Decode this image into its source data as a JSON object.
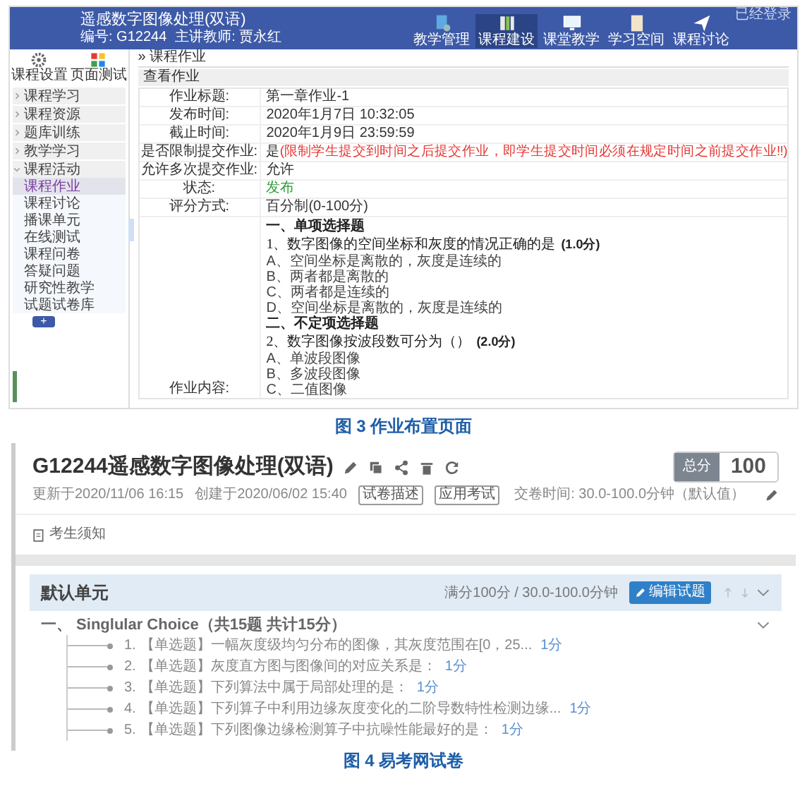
{
  "figure3": {
    "caption": "图 3 作业布置页面",
    "header": {
      "title": "遥感数字图像处理(双语)",
      "code": "编号: G12244",
      "teacher": "主讲教师: 贾永红",
      "login": "已经登录",
      "toolbar": [
        {
          "kind": "settings",
          "label": "教学管理",
          "selected": false
        },
        {
          "kind": "chart",
          "label": "课程建设",
          "selected": true
        },
        {
          "kind": "monitor",
          "label": "课堂教学",
          "selected": false
        },
        {
          "kind": "document",
          "label": "学习空间",
          "selected": false
        },
        {
          "kind": "send",
          "label": "课程讨论",
          "selected": false
        }
      ]
    },
    "sidebar": {
      "tools": [
        {
          "kind": "gear",
          "label": "课程设置"
        },
        {
          "kind": "grid",
          "label": "页面测试"
        }
      ],
      "groups": [
        {
          "label": "课程学习",
          "expanded": false
        },
        {
          "label": "课程资源",
          "expanded": false
        },
        {
          "label": "题库训练",
          "expanded": false
        },
        {
          "label": "教学学习",
          "expanded": false
        },
        {
          "label": "课程活动",
          "expanded": true,
          "children": [
            {
              "label": "课程作业",
              "selected": true
            },
            {
              "label": "课程讨论",
              "selected": false
            },
            {
              "label": "播课单元",
              "selected": false
            },
            {
              "label": "在线测试",
              "selected": false
            },
            {
              "label": "课程问卷",
              "selected": false
            },
            {
              "label": "答疑问题",
              "selected": false
            },
            {
              "label": "研究性教学",
              "selected": false
            },
            {
              "label": "试题试卷库",
              "selected": false
            }
          ]
        }
      ],
      "add_button": "+"
    },
    "breadcrumb": "» 课程作业",
    "section": "查看作业",
    "rows": [
      {
        "kind": "text",
        "label": "作业标题:",
        "value": "第一章作业-1"
      },
      {
        "kind": "text",
        "label": "发布时间:",
        "value": "2020年1月7日 10:32:05"
      },
      {
        "kind": "text",
        "label": "截止时间:",
        "value": "2020年1月9日 23:59:59"
      },
      {
        "kind": "warning",
        "label": "是否限制提交作业:",
        "value": "是",
        "note": "(限制学生提交到时间之后提交作业，即学生提交时间必须在规定时间之前提交作业!!)"
      },
      {
        "kind": "text",
        "label": "允许多次提交作业:",
        "value": "允许"
      },
      {
        "kind": "status",
        "label": "状态:",
        "value": "发布"
      },
      {
        "kind": "text",
        "label": "评分方式:",
        "value": "百分制(0-100分)"
      }
    ],
    "content_label": "作业内容:",
    "content": [
      {
        "kind": "heading",
        "text": "一、单项选择题"
      },
      {
        "kind": "question",
        "text": "1、数字图像的空间坐标和灰度的情况正确的是",
        "score": "(1.0分)"
      },
      {
        "kind": "option",
        "text": "A、空间坐标是离散的，灰度是连续的"
      },
      {
        "kind": "option",
        "text": "B、两者都是离散的"
      },
      {
        "kind": "option",
        "text": "C、两者都是连续的"
      },
      {
        "kind": "option",
        "text": "D、空间坐标是离散的，灰度是连续的"
      },
      {
        "kind": "heading",
        "text": "二、不定项选择题"
      },
      {
        "kind": "question",
        "text": "2、数字图像按波段数可分为（）",
        "score": "(2.0分)"
      },
      {
        "kind": "option",
        "text": "A、单波段图像"
      },
      {
        "kind": "option",
        "text": "B、多波段图像"
      },
      {
        "kind": "option",
        "text": "C、二值图像"
      }
    ]
  },
  "figure4": {
    "caption": "图 4 易考网试卷",
    "title": "G12244遥感数字图像处理(双语)",
    "actions": [
      {
        "kind": "edit"
      },
      {
        "kind": "copy"
      },
      {
        "kind": "share"
      },
      {
        "kind": "delete"
      },
      {
        "kind": "refresh"
      }
    ],
    "updated": "更新于2020/11/06 16:15",
    "created": "创建于2020/06/02 15:40",
    "tags": [
      "试卷描述",
      "应用考试"
    ],
    "total_label": "总分",
    "total_value": "100",
    "submit_time": "交卷时间: 30.0-100.0分钟（默认值）",
    "notice": "考生须知",
    "unit": {
      "title": "默认单元",
      "summary": "满分100分 / 30.0-100.0分钟",
      "edit_button": "编辑试题"
    },
    "section": "一、 Singlular Choice（共15题 共计15分）",
    "questions": [
      {
        "number": "1.",
        "text": "【单选题】一幅灰度级均匀分布的图像，其灰度范围在[0，25...",
        "score": "1分"
      },
      {
        "number": "2.",
        "text": "【单选题】灰度直方图与图像间的对应关系是：",
        "score": "1分"
      },
      {
        "number": "3.",
        "text": "【单选题】下列算法中属于局部处理的是：",
        "score": "1分"
      },
      {
        "number": "4.",
        "text": "【单选题】下列算子中利用边缘灰度变化的二阶导数特性检测边缘...",
        "score": "1分"
      },
      {
        "number": "5.",
        "text": "【单选题】下列图像边缘检测算子中抗噪性能最好的是：",
        "score": "1分"
      }
    ]
  }
}
